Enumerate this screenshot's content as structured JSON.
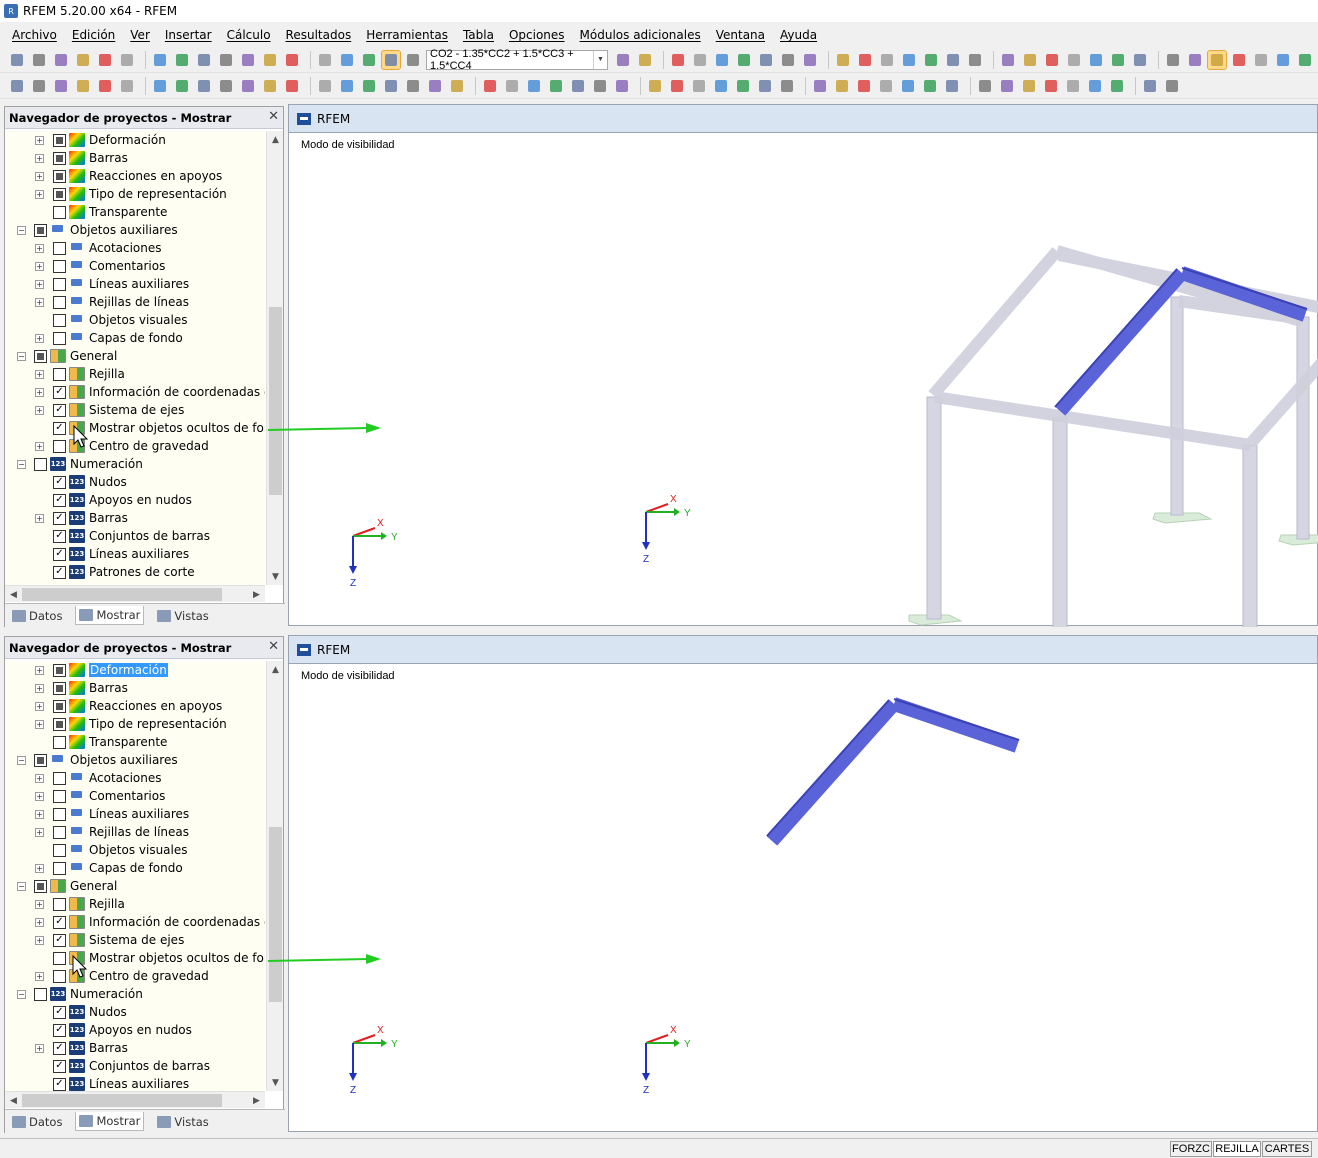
{
  "app": {
    "title": "RFEM 5.20.00 x64 - RFEM",
    "icon_name": "rfem-icon"
  },
  "menu": [
    "Archivo",
    "Edición",
    "Ver",
    "Insertar",
    "Cálculo",
    "Resultados",
    "Herramientas",
    "Tabla",
    "Opciones",
    "Módulos adicionales",
    "Ventana",
    "Ayuda"
  ],
  "toolbar": {
    "load_combo": "CO2 - 1.35*CC2 + 1.5*CC3 + 1.5*CC4"
  },
  "navigator_top": {
    "title": "Navegador de proyectos - Mostrar",
    "items": [
      {
        "label": "Deformación",
        "level": 2,
        "exp": true,
        "check": "part",
        "icon": "col"
      },
      {
        "label": "Barras",
        "level": 2,
        "exp": true,
        "check": "part",
        "icon": "col"
      },
      {
        "label": "Reacciones en apoyos",
        "level": 2,
        "exp": true,
        "check": "part",
        "icon": "col"
      },
      {
        "label": "Tipo de representación",
        "level": 2,
        "exp": true,
        "check": "part",
        "icon": "col"
      },
      {
        "label": "Transparente",
        "level": 2,
        "exp": false,
        "check": "off",
        "icon": "col"
      },
      {
        "label": "Objetos auxiliares",
        "level": 1,
        "exp": true,
        "check": "part",
        "icon": "aux"
      },
      {
        "label": "Acotaciones",
        "level": 2,
        "exp": true,
        "check": "off",
        "icon": "aux"
      },
      {
        "label": "Comentarios",
        "level": 2,
        "exp": true,
        "check": "off",
        "icon": "aux"
      },
      {
        "label": "Líneas auxiliares",
        "level": 2,
        "exp": true,
        "check": "off",
        "icon": "aux"
      },
      {
        "label": "Rejillas de líneas",
        "level": 2,
        "exp": true,
        "check": "off",
        "icon": "aux"
      },
      {
        "label": "Objetos visuales",
        "level": 2,
        "exp": false,
        "check": "off",
        "icon": "aux"
      },
      {
        "label": "Capas de fondo",
        "level": 2,
        "exp": true,
        "check": "off",
        "icon": "aux"
      },
      {
        "label": "General",
        "level": 1,
        "exp": true,
        "check": "part",
        "icon": "gen"
      },
      {
        "label": "Rejilla",
        "level": 2,
        "exp": true,
        "check": "off",
        "icon": "gen"
      },
      {
        "label": "Información de coordenadas en e",
        "level": 2,
        "exp": true,
        "check": "on",
        "icon": "gen"
      },
      {
        "label": "Sistema de ejes",
        "level": 2,
        "exp": true,
        "check": "on",
        "icon": "gen"
      },
      {
        "label": "Mostrar objetos ocultos de fondo",
        "level": 2,
        "exp": false,
        "check": "on",
        "icon": "gen"
      },
      {
        "label": "Centro de gravedad",
        "level": 2,
        "exp": true,
        "check": "off",
        "icon": "gen"
      },
      {
        "label": "Numeración",
        "level": 1,
        "exp": true,
        "check": "off",
        "icon": "num"
      },
      {
        "label": "Nudos",
        "level": 2,
        "exp": false,
        "check": "on",
        "icon": "num"
      },
      {
        "label": "Apoyos en nudos",
        "level": 2,
        "exp": false,
        "check": "on",
        "icon": "num"
      },
      {
        "label": "Barras",
        "level": 2,
        "exp": true,
        "check": "on",
        "icon": "num"
      },
      {
        "label": "Conjuntos de barras",
        "level": 2,
        "exp": false,
        "check": "on",
        "icon": "num"
      },
      {
        "label": "Líneas auxiliares",
        "level": 2,
        "exp": false,
        "check": "on",
        "icon": "num"
      },
      {
        "label": "Patrones de corte",
        "level": 2,
        "exp": false,
        "check": "on",
        "icon": "num"
      }
    ],
    "tabs": [
      "Datos",
      "Mostrar",
      "Vistas"
    ],
    "active_tab": "Mostrar"
  },
  "navigator_bottom": {
    "title": "Navegador de proyectos - Mostrar",
    "items": [
      {
        "label": "Deformación",
        "level": 2,
        "exp": true,
        "check": "part",
        "icon": "col",
        "selected": true
      },
      {
        "label": "Barras",
        "level": 2,
        "exp": true,
        "check": "part",
        "icon": "col"
      },
      {
        "label": "Reacciones en apoyos",
        "level": 2,
        "exp": true,
        "check": "part",
        "icon": "col"
      },
      {
        "label": "Tipo de representación",
        "level": 2,
        "exp": true,
        "check": "part",
        "icon": "col"
      },
      {
        "label": "Transparente",
        "level": 2,
        "exp": false,
        "check": "off",
        "icon": "col"
      },
      {
        "label": "Objetos auxiliares",
        "level": 1,
        "exp": true,
        "check": "part",
        "icon": "aux"
      },
      {
        "label": "Acotaciones",
        "level": 2,
        "exp": true,
        "check": "off",
        "icon": "aux"
      },
      {
        "label": "Comentarios",
        "level": 2,
        "exp": true,
        "check": "off",
        "icon": "aux"
      },
      {
        "label": "Líneas auxiliares",
        "level": 2,
        "exp": true,
        "check": "off",
        "icon": "aux"
      },
      {
        "label": "Rejillas de líneas",
        "level": 2,
        "exp": true,
        "check": "off",
        "icon": "aux"
      },
      {
        "label": "Objetos visuales",
        "level": 2,
        "exp": false,
        "check": "off",
        "icon": "aux"
      },
      {
        "label": "Capas de fondo",
        "level": 2,
        "exp": true,
        "check": "off",
        "icon": "aux"
      },
      {
        "label": "General",
        "level": 1,
        "exp": true,
        "check": "part",
        "icon": "gen"
      },
      {
        "label": "Rejilla",
        "level": 2,
        "exp": true,
        "check": "off",
        "icon": "gen"
      },
      {
        "label": "Información de coordenadas en e",
        "level": 2,
        "exp": true,
        "check": "on",
        "icon": "gen"
      },
      {
        "label": "Sistema de ejes",
        "level": 2,
        "exp": true,
        "check": "on",
        "icon": "gen"
      },
      {
        "label": "Mostrar objetos ocultos de fondo",
        "level": 2,
        "exp": false,
        "check": "off",
        "icon": "gen"
      },
      {
        "label": "Centro de gravedad",
        "level": 2,
        "exp": true,
        "check": "off",
        "icon": "gen"
      },
      {
        "label": "Numeración",
        "level": 1,
        "exp": true,
        "check": "off",
        "icon": "num"
      },
      {
        "label": "Nudos",
        "level": 2,
        "exp": false,
        "check": "on",
        "icon": "num"
      },
      {
        "label": "Apoyos en nudos",
        "level": 2,
        "exp": false,
        "check": "on",
        "icon": "num"
      },
      {
        "label": "Barras",
        "level": 2,
        "exp": true,
        "check": "on",
        "icon": "num"
      },
      {
        "label": "Conjuntos de barras",
        "level": 2,
        "exp": false,
        "check": "on",
        "icon": "num"
      },
      {
        "label": "Líneas auxiliares",
        "level": 2,
        "exp": false,
        "check": "on",
        "icon": "num"
      }
    ],
    "tabs": [
      "Datos",
      "Mostrar",
      "Vistas"
    ],
    "active_tab": "Mostrar"
  },
  "view_top": {
    "title": "RFEM",
    "mode_label": "Modo de visibilidad"
  },
  "view_bottom": {
    "title": "RFEM",
    "mode_label": "Modo de visibilidad"
  },
  "axes": {
    "x": "X",
    "y": "Y",
    "z": "Z"
  },
  "status": [
    "FORZC",
    "REJILLA",
    "CARTES"
  ],
  "colors": {
    "member_highlight": "#5b63d8",
    "member_ghost": "#d4d4e2",
    "support": "#d9ecd9",
    "arrow": "#22cc22",
    "axis_x": "#e02020",
    "axis_y": "#20b020",
    "axis_z": "#2030c0"
  }
}
